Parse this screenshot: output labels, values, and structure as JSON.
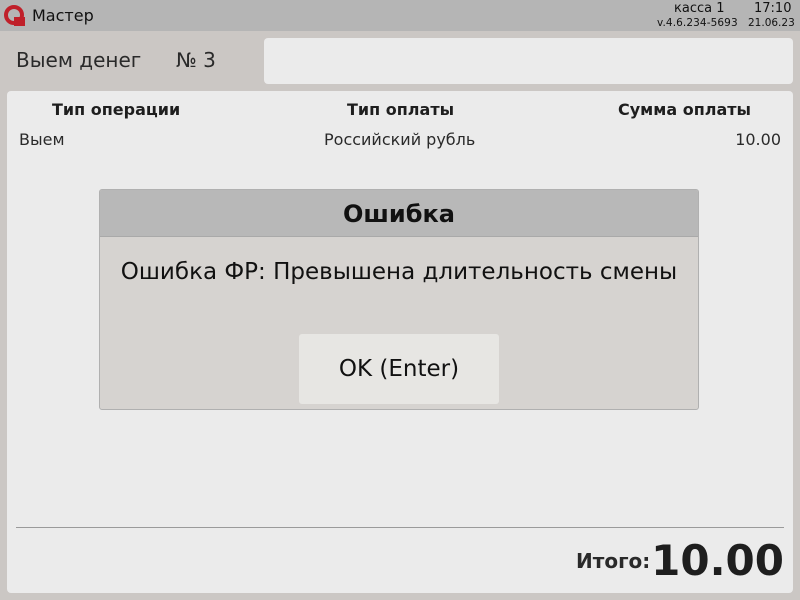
{
  "titlebar": {
    "app_name": "Мастер",
    "kassa": "касса 1",
    "time": "17:10",
    "version": "v.4.6.234-5693",
    "date": "21.06.23",
    "logo_icon": "cash-register-logo-icon"
  },
  "document": {
    "title": "Выем денег",
    "number": "№ 3",
    "input_value": ""
  },
  "table": {
    "headers": [
      "Тип операции",
      "Тип оплаты",
      "Сумма оплаты"
    ],
    "rows": [
      [
        "Выем",
        "Российский рубль",
        "10.00"
      ]
    ]
  },
  "total": {
    "label": "Итого:",
    "value": "10.00"
  },
  "dialog": {
    "title": "Ошибка",
    "message": "Ошибка ФР: Превышена длительность смены",
    "ok_label": "OK (Enter)"
  },
  "colors": {
    "brand": "#c0202a",
    "background": "#cbc7c4",
    "titlebar": "#b5b5b5",
    "panel": "#ebebeb"
  }
}
